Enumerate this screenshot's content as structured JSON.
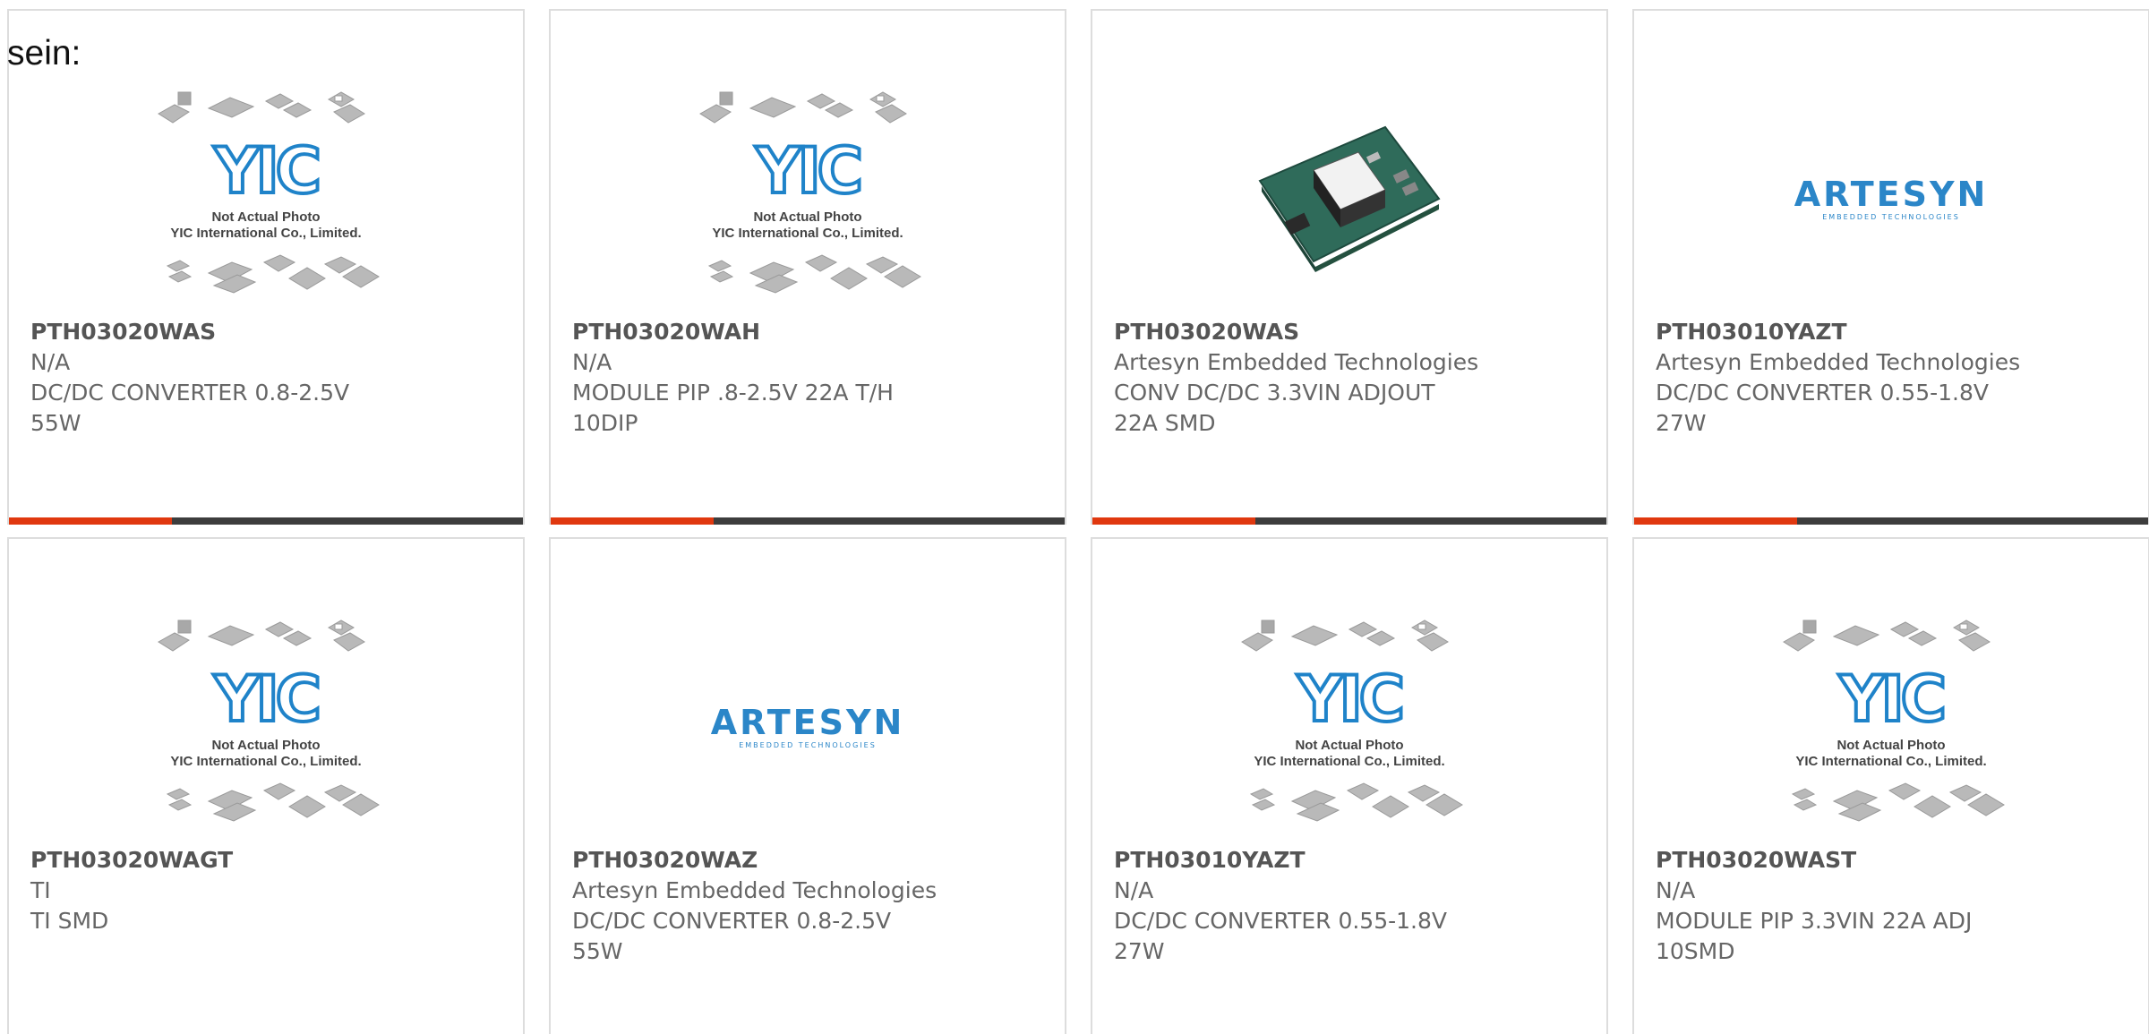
{
  "lead_text": "sein:",
  "colors": {
    "accent": "#e0380f",
    "bar": "#3d3d3d",
    "border": "#dddddd",
    "yic_blue": "#1f83c9",
    "artesyn_blue": "#2b86c8",
    "text": "#666666"
  },
  "placeholder": {
    "line1": "Not Actual Photo",
    "line2": "YIC International Co., Limited.",
    "logo": "YIC"
  },
  "artesyn": {
    "word": "ARTESYN",
    "sub": "EMBEDDED TECHNOLOGIES"
  },
  "products": [
    {
      "part": "PTH03020WAS",
      "maker": "N/A",
      "desc": "DC/DC CONVERTER 0.8-2.5V\n55W",
      "image": "yic-placeholder",
      "bar": true
    },
    {
      "part": "PTH03020WAH",
      "maker": "N/A",
      "desc": "MODULE PIP .8-2.5V 22A T/H\n10DIP",
      "image": "yic-placeholder",
      "bar": true
    },
    {
      "part": "PTH03020WAS",
      "maker": "Artesyn Embedded Technologies",
      "desc": "CONV DC/DC 3.3VIN ADJOUT\n22A SMD",
      "image": "pcb-module-photo",
      "bar": true
    },
    {
      "part": "PTH03010YAZT",
      "maker": "Artesyn Embedded Technologies",
      "desc": "DC/DC CONVERTER 0.55-1.8V\n27W",
      "image": "artesyn-logo",
      "bar": true
    },
    {
      "part": "PTH03020WAGT",
      "maker": "TI",
      "desc": "TI SMD",
      "image": "yic-placeholder",
      "bar": false
    },
    {
      "part": "PTH03020WAZ",
      "maker": "Artesyn Embedded Technologies",
      "desc": "DC/DC CONVERTER 0.8-2.5V\n55W",
      "image": "artesyn-logo",
      "bar": false
    },
    {
      "part": "PTH03010YAZT",
      "maker": "N/A",
      "desc": "DC/DC CONVERTER 0.55-1.8V\n27W",
      "image": "yic-placeholder",
      "bar": false
    },
    {
      "part": "PTH03020WAST",
      "maker": "N/A",
      "desc": "MODULE PIP 3.3VIN 22A ADJ\n10SMD",
      "image": "yic-placeholder",
      "bar": false
    }
  ]
}
